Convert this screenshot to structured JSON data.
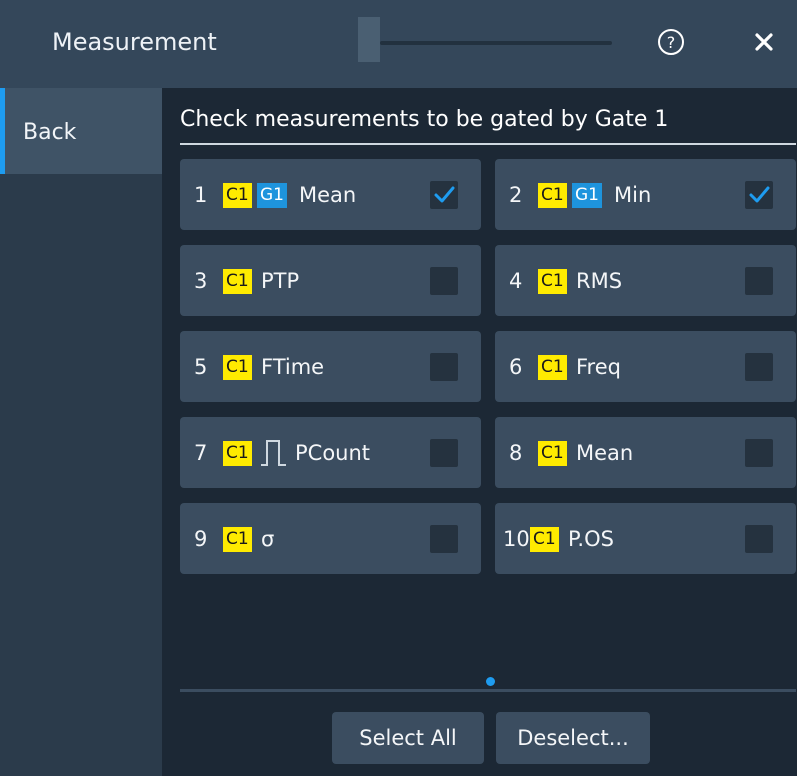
{
  "window": {
    "title": "Measurement"
  },
  "sidebar": {
    "back_label": "Back"
  },
  "content": {
    "heading": "Check measurements to be gated by Gate 1"
  },
  "measurements": [
    {
      "num": "1",
      "source": "C1",
      "gate": "G1",
      "name": "Mean",
      "checked": true
    },
    {
      "num": "2",
      "source": "C1",
      "gate": "G1",
      "name": "Min",
      "checked": true
    },
    {
      "num": "3",
      "source": "C1",
      "name": "PTP",
      "checked": false
    },
    {
      "num": "4",
      "source": "C1",
      "name": "RMS",
      "checked": false
    },
    {
      "num": "5",
      "source": "C1",
      "name": "FTime",
      "checked": false
    },
    {
      "num": "6",
      "source": "C1",
      "name": "Freq",
      "checked": false
    },
    {
      "num": "7",
      "source": "C1",
      "icon": "pulse-icon",
      "name": "PCount",
      "checked": false
    },
    {
      "num": "8",
      "source": "C1",
      "name": "Mean",
      "checked": false
    },
    {
      "num": "9",
      "source": "C1",
      "name": "σ",
      "checked": false
    },
    {
      "num": "10",
      "source": "C1",
      "name": "P.OS",
      "checked": false
    }
  ],
  "buttons": {
    "select_all": "Select All",
    "deselect": "Deselect..."
  },
  "colors": {
    "accent": "#1e9cf0",
    "c1_badge": "#ffeb00",
    "g1_badge": "#1e94dd",
    "tile": "#3b4d60"
  }
}
